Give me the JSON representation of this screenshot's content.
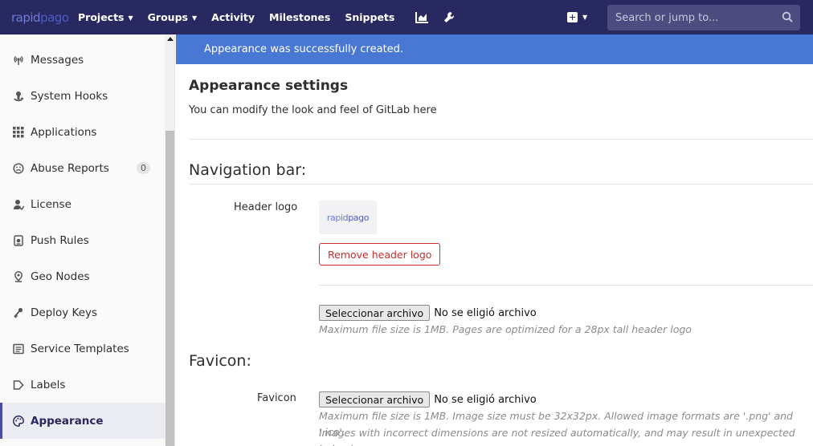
{
  "navbar": {
    "logo_text_a": "rapid",
    "logo_text_b": "pago",
    "links": [
      {
        "label": "Projects",
        "has_caret": true
      },
      {
        "label": "Groups",
        "has_caret": true
      },
      {
        "label": "Activity",
        "has_caret": false
      },
      {
        "label": "Milestones",
        "has_caret": false
      },
      {
        "label": "Snippets",
        "has_caret": false
      }
    ],
    "search_placeholder": "Search or jump to...",
    "bg_color": "#292961"
  },
  "sidebar": {
    "items": [
      {
        "label": "Messages",
        "icon": "broadcast-icon"
      },
      {
        "label": "System Hooks",
        "icon": "hook-icon"
      },
      {
        "label": "Applications",
        "icon": "grid-icon"
      },
      {
        "label": "Abuse Reports",
        "icon": "frown-icon",
        "badge": "0"
      },
      {
        "label": "License",
        "icon": "user-license-icon"
      },
      {
        "label": "Push Rules",
        "icon": "push-rules-icon"
      },
      {
        "label": "Geo Nodes",
        "icon": "map-pin-icon"
      },
      {
        "label": "Deploy Keys",
        "icon": "key-icon"
      },
      {
        "label": "Service Templates",
        "icon": "template-icon"
      },
      {
        "label": "Labels",
        "icon": "label-icon"
      },
      {
        "label": "Appearance",
        "icon": "palette-icon",
        "active": true
      }
    ]
  },
  "flash": {
    "message": "Appearance was successfully created.",
    "color": "#4878d4"
  },
  "main": {
    "title": "Appearance settings",
    "description": "You can modify the look and feel of GitLab here",
    "nav_section": "Navigation bar:",
    "header_logo_label": "Header logo",
    "preview_logo_a": "rapid",
    "preview_logo_b": "pago",
    "remove_button": "Remove header logo",
    "file_button": "Seleccionar archivo",
    "file_status": "No se eligió archivo",
    "header_logo_help": "Maximum file size is 1MB. Pages are optimized for a 28px tall header logo",
    "favicon_section": "Favicon:",
    "favicon_label": "Favicon",
    "favicon_help_1": "Maximum file size is 1MB. Image size must be 32x32px. Allowed image formats are '.png' and '.ico'.",
    "favicon_help_2": "Images with incorrect dimensions are not resized automatically, and may result in unexpected behavior."
  }
}
